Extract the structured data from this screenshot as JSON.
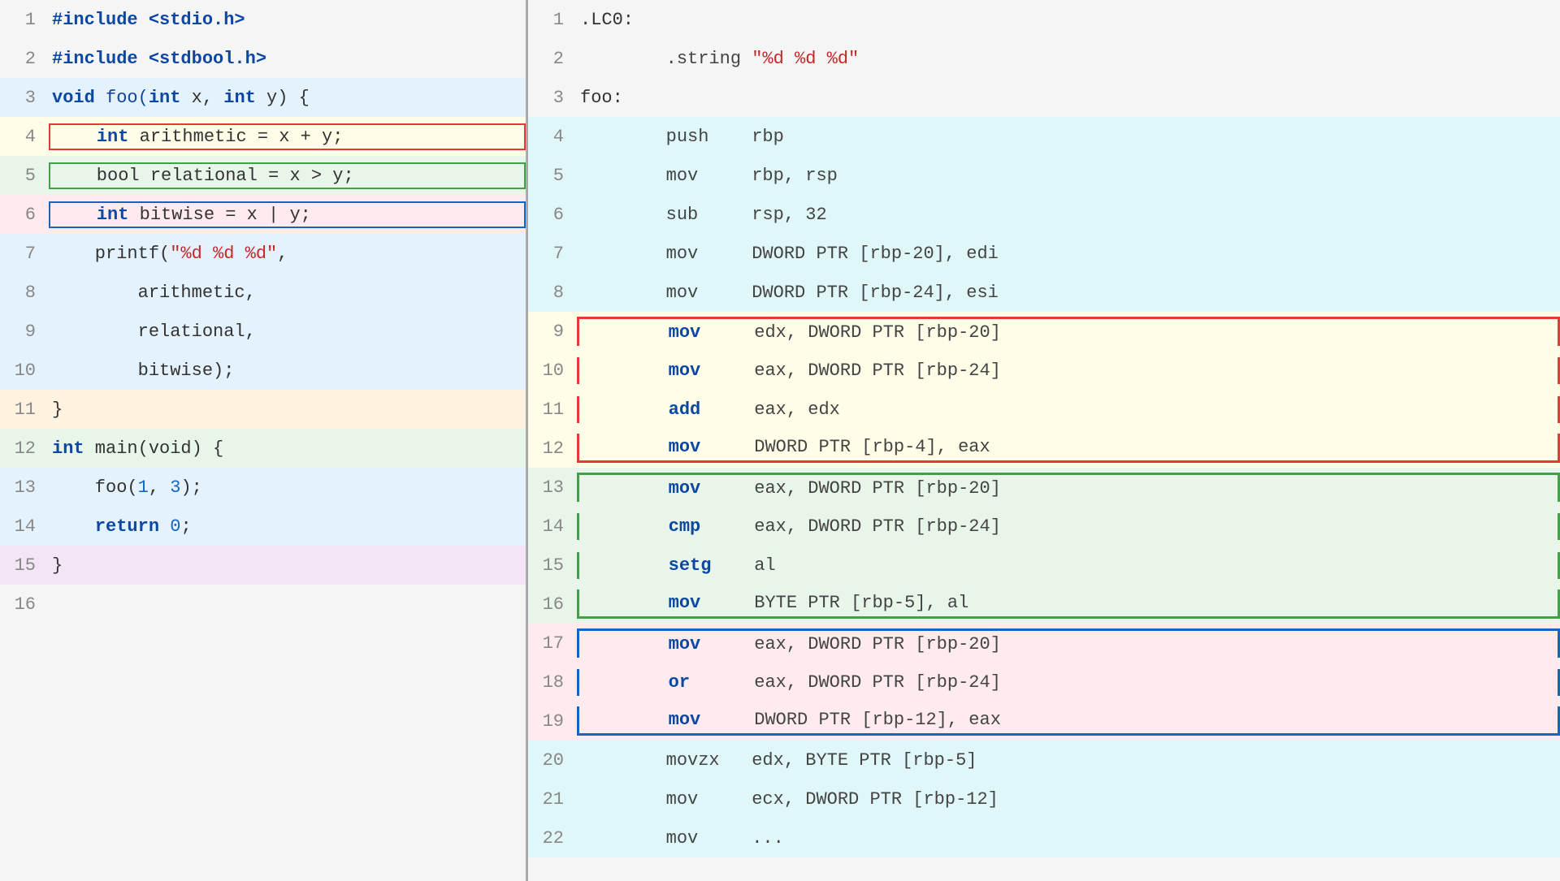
{
  "left": {
    "lines": [
      {
        "num": 1,
        "bg": "default",
        "tokens": [
          {
            "t": "#include <stdio.h>",
            "c": "kw"
          }
        ]
      },
      {
        "num": 2,
        "bg": "default",
        "tokens": [
          {
            "t": "#include <stdbool.h>",
            "c": "kw"
          }
        ]
      },
      {
        "num": 3,
        "bg": "blue-bg",
        "tokens": [
          {
            "t": "void ",
            "c": "kw"
          },
          {
            "t": "foo(",
            "c": "fn"
          },
          {
            "t": "int",
            "c": "kw"
          },
          {
            "t": " x, ",
            "c": ""
          },
          {
            "t": "int",
            "c": "kw"
          },
          {
            "t": " y) {",
            "c": ""
          }
        ]
      },
      {
        "num": 4,
        "bg": "yellow",
        "border": "red",
        "tokens": [
          {
            "t": "    ",
            "c": ""
          },
          {
            "t": "int",
            "c": "kw"
          },
          {
            "t": " arithmetic = x + y;",
            "c": ""
          }
        ]
      },
      {
        "num": 5,
        "bg": "green",
        "border": "green",
        "tokens": [
          {
            "t": "    bool relational = x > y;",
            "c": ""
          }
        ]
      },
      {
        "num": 6,
        "bg": "red-bg",
        "border": "blue",
        "tokens": [
          {
            "t": "    ",
            "c": ""
          },
          {
            "t": "int",
            "c": "kw"
          },
          {
            "t": " bitwise = x | y;",
            "c": ""
          }
        ]
      },
      {
        "num": 7,
        "bg": "blue-bg",
        "tokens": [
          {
            "t": "    printf(",
            "c": ""
          },
          {
            "t": "\"%d %d %d\"",
            "c": "str"
          },
          {
            "t": ",",
            "c": ""
          }
        ]
      },
      {
        "num": 8,
        "bg": "blue-bg",
        "tokens": [
          {
            "t": "        arithmetic,",
            "c": ""
          }
        ]
      },
      {
        "num": 9,
        "bg": "blue-bg",
        "tokens": [
          {
            "t": "        relational,",
            "c": ""
          }
        ]
      },
      {
        "num": 10,
        "bg": "blue-bg",
        "tokens": [
          {
            "t": "        bitwise);",
            "c": ""
          }
        ]
      },
      {
        "num": 11,
        "bg": "orange-bg",
        "tokens": [
          {
            "t": "}",
            "c": ""
          }
        ]
      },
      {
        "num": 12,
        "bg": "green",
        "tokens": [
          {
            "t": "",
            "c": "kw"
          },
          {
            "t": "int",
            "c": "kw"
          },
          {
            "t": " main(void) {",
            "c": ""
          }
        ]
      },
      {
        "num": 13,
        "bg": "blue-bg",
        "tokens": [
          {
            "t": "    foo(",
            "c": ""
          },
          {
            "t": "1",
            "c": "num"
          },
          {
            "t": ", ",
            "c": ""
          },
          {
            "t": "3",
            "c": "num"
          },
          {
            "t": ");",
            "c": ""
          }
        ]
      },
      {
        "num": 14,
        "bg": "blue-bg",
        "tokens": [
          {
            "t": "    ",
            "c": ""
          },
          {
            "t": "return",
            "c": "kw"
          },
          {
            "t": " ",
            "c": ""
          },
          {
            "t": "0",
            "c": "num"
          },
          {
            "t": ";",
            "c": ""
          }
        ]
      },
      {
        "num": 15,
        "bg": "purple-bg",
        "tokens": [
          {
            "t": "}",
            "c": ""
          }
        ]
      },
      {
        "num": 16,
        "bg": "default",
        "tokens": [
          {
            "t": "",
            "c": ""
          }
        ]
      }
    ]
  },
  "right": {
    "lines": [
      {
        "num": 1,
        "bg": "default",
        "tokens": [
          {
            "t": ".LC0:",
            "c": "asm-label"
          }
        ]
      },
      {
        "num": 2,
        "bg": "default",
        "tokens": [
          {
            "t": "        .string ",
            "c": "asm-reg"
          },
          {
            "t": "\"%d %d %d\"",
            "c": "asm-str"
          }
        ]
      },
      {
        "num": 3,
        "bg": "default",
        "tokens": [
          {
            "t": "foo:",
            "c": "asm-label"
          }
        ]
      },
      {
        "num": 4,
        "bg": "cyan-bg",
        "tokens": [
          {
            "t": "        push    rbp",
            "c": "asm-reg"
          }
        ]
      },
      {
        "num": 5,
        "bg": "cyan-bg",
        "tokens": [
          {
            "t": "        mov     rbp, rsp",
            "c": "asm-reg"
          }
        ]
      },
      {
        "num": 6,
        "bg": "cyan-bg",
        "tokens": [
          {
            "t": "        sub     rsp, 32",
            "c": "asm-reg"
          }
        ]
      },
      {
        "num": 7,
        "bg": "cyan-bg",
        "tokens": [
          {
            "t": "        mov     DWORD PTR [rbp-20], edi",
            "c": "asm-reg"
          }
        ]
      },
      {
        "num": 8,
        "bg": "cyan-bg",
        "tokens": [
          {
            "t": "        mov     DWORD PTR [rbp-24], esi",
            "c": "asm-reg"
          }
        ]
      },
      {
        "num": 9,
        "bg": "yellow-asm",
        "border": "red",
        "tokens": [
          {
            "t": "        ",
            "c": ""
          },
          {
            "t": "mov",
            "c": "asm-op"
          },
          {
            "t": "     edx, DWORD PTR [rbp-20]",
            "c": "asm-reg"
          }
        ]
      },
      {
        "num": 10,
        "bg": "yellow-asm",
        "border": "red",
        "tokens": [
          {
            "t": "        ",
            "c": ""
          },
          {
            "t": "mov",
            "c": "asm-op"
          },
          {
            "t": "     eax, DWORD PTR [rbp-24]",
            "c": "asm-reg"
          }
        ]
      },
      {
        "num": 11,
        "bg": "yellow-asm",
        "border": "red",
        "tokens": [
          {
            "t": "        ",
            "c": ""
          },
          {
            "t": "add",
            "c": "asm-op"
          },
          {
            "t": "     eax, edx",
            "c": "asm-reg"
          }
        ]
      },
      {
        "num": 12,
        "bg": "yellow-asm",
        "border": "red",
        "tokens": [
          {
            "t": "        ",
            "c": ""
          },
          {
            "t": "mov",
            "c": "asm-op"
          },
          {
            "t": "     DWORD PTR [rbp-4], eax",
            "c": "asm-reg"
          }
        ]
      },
      {
        "num": 13,
        "bg": "green-asm",
        "border": "green",
        "tokens": [
          {
            "t": "        ",
            "c": ""
          },
          {
            "t": "mov",
            "c": "asm-op"
          },
          {
            "t": "     eax, DWORD PTR [rbp-20]",
            "c": "asm-reg"
          }
        ]
      },
      {
        "num": 14,
        "bg": "green-asm",
        "border": "green",
        "tokens": [
          {
            "t": "        ",
            "c": ""
          },
          {
            "t": "cmp",
            "c": "asm-op"
          },
          {
            "t": "     eax, DWORD PTR [rbp-24]",
            "c": "asm-reg"
          }
        ]
      },
      {
        "num": 15,
        "bg": "green-asm",
        "border": "green",
        "tokens": [
          {
            "t": "        ",
            "c": ""
          },
          {
            "t": "setg",
            "c": "asm-op"
          },
          {
            "t": "    al",
            "c": "asm-reg"
          }
        ]
      },
      {
        "num": 16,
        "bg": "green-asm",
        "border": "green",
        "tokens": [
          {
            "t": "        ",
            "c": ""
          },
          {
            "t": "mov",
            "c": "asm-op"
          },
          {
            "t": "     BYTE PTR [rbp-5], al",
            "c": "asm-reg"
          }
        ]
      },
      {
        "num": 17,
        "bg": "salmon-asm",
        "border": "blue",
        "tokens": [
          {
            "t": "        ",
            "c": ""
          },
          {
            "t": "mov",
            "c": "asm-op"
          },
          {
            "t": "     eax, DWORD PTR [rbp-20]",
            "c": "asm-reg"
          }
        ]
      },
      {
        "num": 18,
        "bg": "salmon-asm",
        "border": "blue",
        "tokens": [
          {
            "t": "        ",
            "c": ""
          },
          {
            "t": "or",
            "c": "asm-op"
          },
          {
            "t": "      eax, DWORD PTR [rbp-24]",
            "c": "asm-reg"
          }
        ]
      },
      {
        "num": 19,
        "bg": "salmon-asm",
        "border": "blue",
        "tokens": [
          {
            "t": "        ",
            "c": ""
          },
          {
            "t": "mov",
            "c": "asm-op"
          },
          {
            "t": "     DWORD PTR [rbp-12], eax",
            "c": "asm-reg"
          }
        ]
      },
      {
        "num": 20,
        "bg": "cyan-bg",
        "tokens": [
          {
            "t": "        movzx   edx, BYTE PTR [rbp-5]",
            "c": "asm-reg"
          }
        ]
      },
      {
        "num": 21,
        "bg": "cyan-bg",
        "tokens": [
          {
            "t": "        mov     ecx, DWORD PTR [rbp-12]",
            "c": "asm-reg"
          }
        ]
      },
      {
        "num": 22,
        "bg": "cyan-bg",
        "tokens": [
          {
            "t": "        mov     ...",
            "c": "asm-reg"
          }
        ]
      }
    ]
  }
}
